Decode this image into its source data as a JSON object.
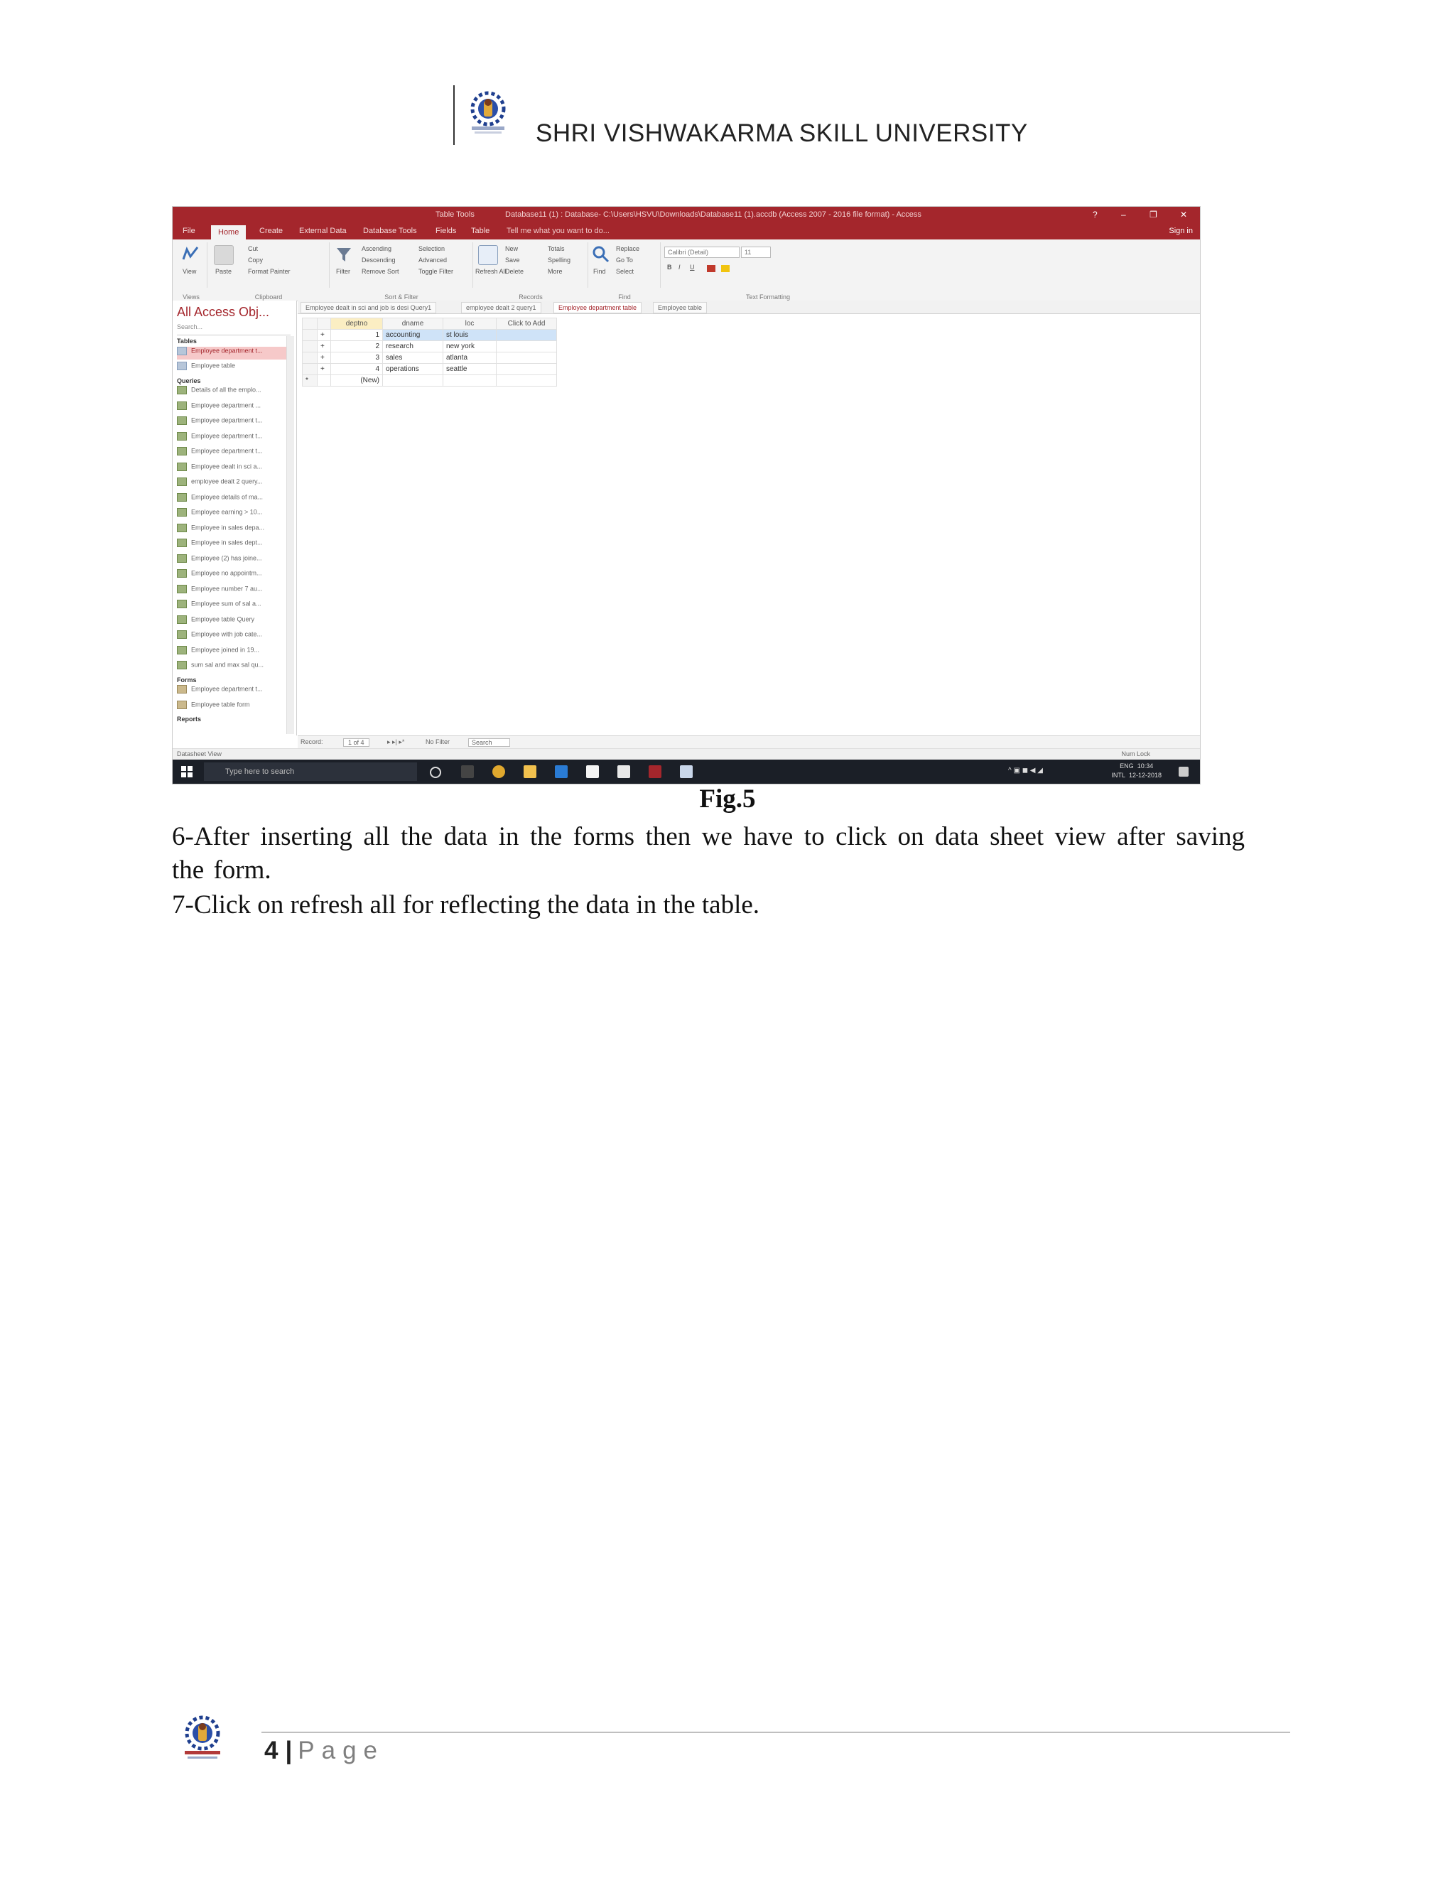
{
  "header": {
    "university": "SHRI VISHWAKARMA SKILL UNIVERSITY"
  },
  "figure": {
    "caption": "Fig.5",
    "screenshot": {
      "title_bar": {
        "contextual": "Table Tools",
        "text": "Database11 (1) : Database- C:\\Users\\HSVU\\Downloads\\Database11 (1).accdb (Access 2007 - 2016 file format) - Access",
        "controls": [
          "?",
          "–",
          "❐",
          "✕"
        ]
      },
      "menu": {
        "items": [
          "File",
          "Home",
          "Create",
          "External Data",
          "Database Tools",
          "Fields",
          "Table"
        ],
        "active": "Home",
        "tell_me": "Tell me what you want to do...",
        "sign_in": "Sign in"
      },
      "ribbon": {
        "groups": [
          {
            "label": "Views",
            "buttons": [
              "View"
            ]
          },
          {
            "label": "Clipboard",
            "buttons": [
              "Paste",
              "Cut",
              "Copy",
              "Format Painter"
            ]
          },
          {
            "label": "Sort & Filter",
            "buttons": [
              "Filter",
              "Ascending",
              "Descending",
              "Remove Sort",
              "Selection",
              "Advanced",
              "Toggle Filter"
            ]
          },
          {
            "label": "Records",
            "buttons": [
              "Refresh All",
              "New",
              "Save",
              "Delete",
              "Totals",
              "Spelling",
              "More"
            ]
          },
          {
            "label": "Find",
            "buttons": [
              "Find",
              "Replace",
              "Go To",
              "Select"
            ]
          },
          {
            "label": "Text Formatting",
            "buttons": [
              "B",
              "I",
              "U"
            ]
          }
        ],
        "font_name": "Calibri (Detail)",
        "font_size": "11"
      },
      "nav_pane": {
        "title": "All Access Obj...",
        "search_placeholder": "Search...",
        "sections": [
          {
            "name": "Tables",
            "items": [
              "Employee department t...",
              "Employee table"
            ]
          },
          {
            "name": "Queries",
            "items": [
              "Details of all the emplo...",
              "Employee department ...",
              "Employee department t...",
              "Employee department t...",
              "Employee department t...",
              "Employee dealt in sci a...",
              "employee dealt 2 query...",
              "Employee details of ma...",
              "Employee earning > 10...",
              "Employee in sales depa...",
              "Employee in sales dept...",
              "Employee (2) has joine...",
              "Employee no appointm...",
              "Employee number 7 au...",
              "Employee sum of sal a...",
              "Employee table Query",
              "Employee with job cate...",
              "Employee joined in 19...",
              "sum sal and max sal qu..."
            ]
          },
          {
            "name": "Forms",
            "items": [
              "Employee department t...",
              "Employee table form"
            ]
          },
          {
            "name": "Reports",
            "items": []
          }
        ]
      },
      "doc_tabs": [
        "Employee dealt in sci and job is desi Query1",
        "employee dealt 2 query1",
        "Employee department table",
        "Employee table"
      ],
      "active_tab": "Employee department table",
      "datasheet": {
        "columns": [
          "deptno",
          "dname",
          "loc",
          "Click to Add"
        ],
        "rows": [
          [
            "1",
            "accounting",
            "st louis"
          ],
          [
            "2",
            "research",
            "new york"
          ],
          [
            "3",
            "sales",
            "atlanta"
          ],
          [
            "4",
            "operations",
            "seattle"
          ]
        ],
        "new_row": "(New)"
      },
      "record_nav": {
        "label": "Record:",
        "position": "1 of 4",
        "filter": "No Filter",
        "search": "Search"
      },
      "status": {
        "left": "Datasheet View",
        "right": "Num Lock"
      },
      "taskbar": {
        "search_placeholder": "Type here to search",
        "lang": "ENG",
        "region": "INTL",
        "time": "10:34",
        "date": "12-12-2018"
      }
    }
  },
  "body": {
    "para1": "6-After inserting all the data in the forms then we have to click on data sheet view after saving the form.",
    "para2": "7-Click on refresh all for reflecting the data in the table."
  },
  "footer": {
    "page_number": "4",
    "separator": "|",
    "page_word": "Page"
  },
  "colors": {
    "access_accent": "#a4262c",
    "taskbar": "#1b1f27"
  }
}
